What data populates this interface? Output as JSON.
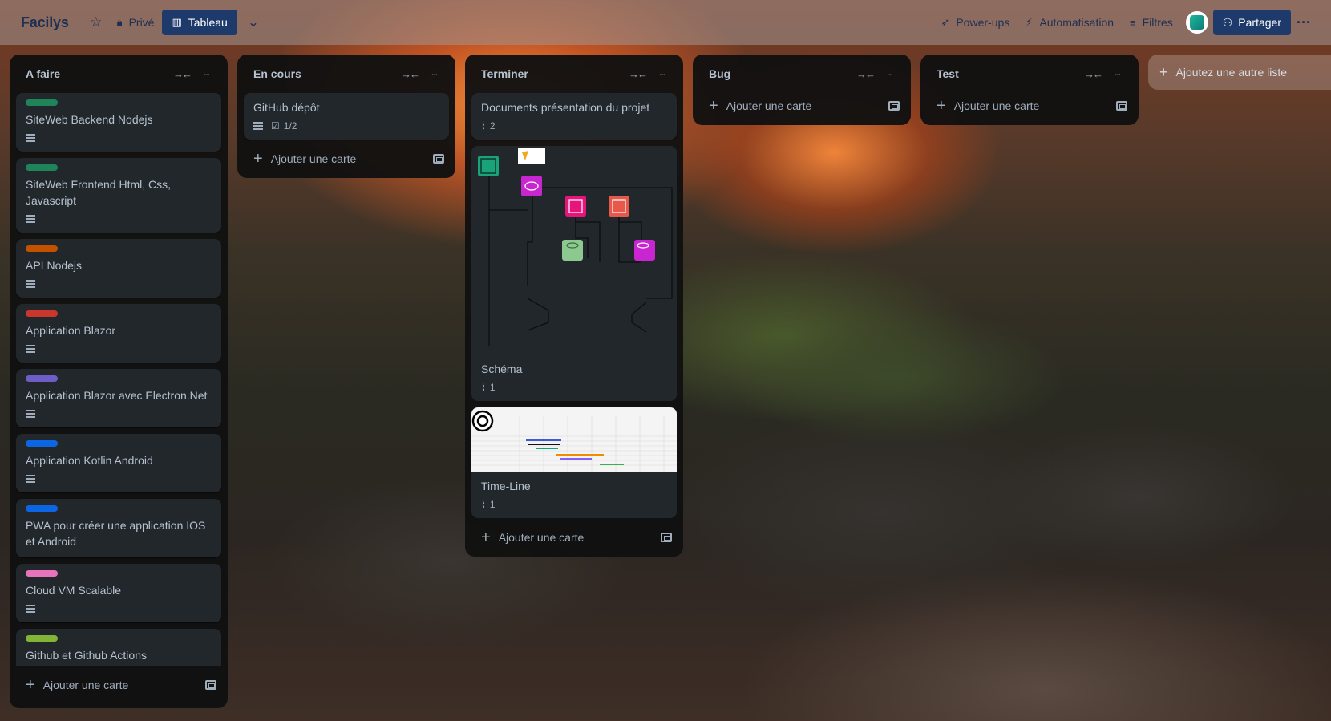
{
  "topbar": {
    "board_title": "Facilys",
    "visibility": "Privé",
    "view": "Tableau",
    "powerups": "Power-ups",
    "automation": "Automatisation",
    "filters": "Filtres",
    "share": "Partager"
  },
  "add_card_label": "Ajouter une carte",
  "add_list_label": "Ajoutez une autre liste",
  "lists": [
    {
      "title": "A faire",
      "cards": [
        {
          "title": "SiteWeb Backend Nodejs",
          "label_color": "#1f845a"
        },
        {
          "title": "SiteWeb Frontend Html, Css, Javascript",
          "label_color": "#1f845a"
        },
        {
          "title": "API Nodejs",
          "label_color": "#c25100"
        },
        {
          "title": "Application Blazor",
          "label_color": "#c9372c"
        },
        {
          "title": "Application Blazor avec Electron.Net",
          "label_color": "#6e5dc6"
        },
        {
          "title": "Application Kotlin Android",
          "label_color": "#0c66e4"
        },
        {
          "title": "PWA pour créer une application IOS et Android",
          "label_color": "#0c66e4"
        },
        {
          "title": "Cloud VM Scalable",
          "label_color": "#e774bb"
        },
        {
          "title": "Github et Github Actions",
          "label_color": "#82b536"
        }
      ]
    },
    {
      "title": "En cours",
      "cards": [
        {
          "title": "GitHub dépôt",
          "checklist": "1/2"
        }
      ]
    },
    {
      "title": "Terminer",
      "cards": [
        {
          "title": "Documents présentation du projet",
          "attachments": "2"
        },
        {
          "title": "Schéma",
          "attachments": "1"
        },
        {
          "title": "Time-Line",
          "attachments": "1"
        }
      ]
    },
    {
      "title": "Bug",
      "cards": []
    },
    {
      "title": "Test",
      "cards": []
    }
  ],
  "colors": {
    "list_bg": "#111111",
    "card_bg": "#22272b",
    "text": "#b6c2cf",
    "accent": "#1d3a6a"
  }
}
